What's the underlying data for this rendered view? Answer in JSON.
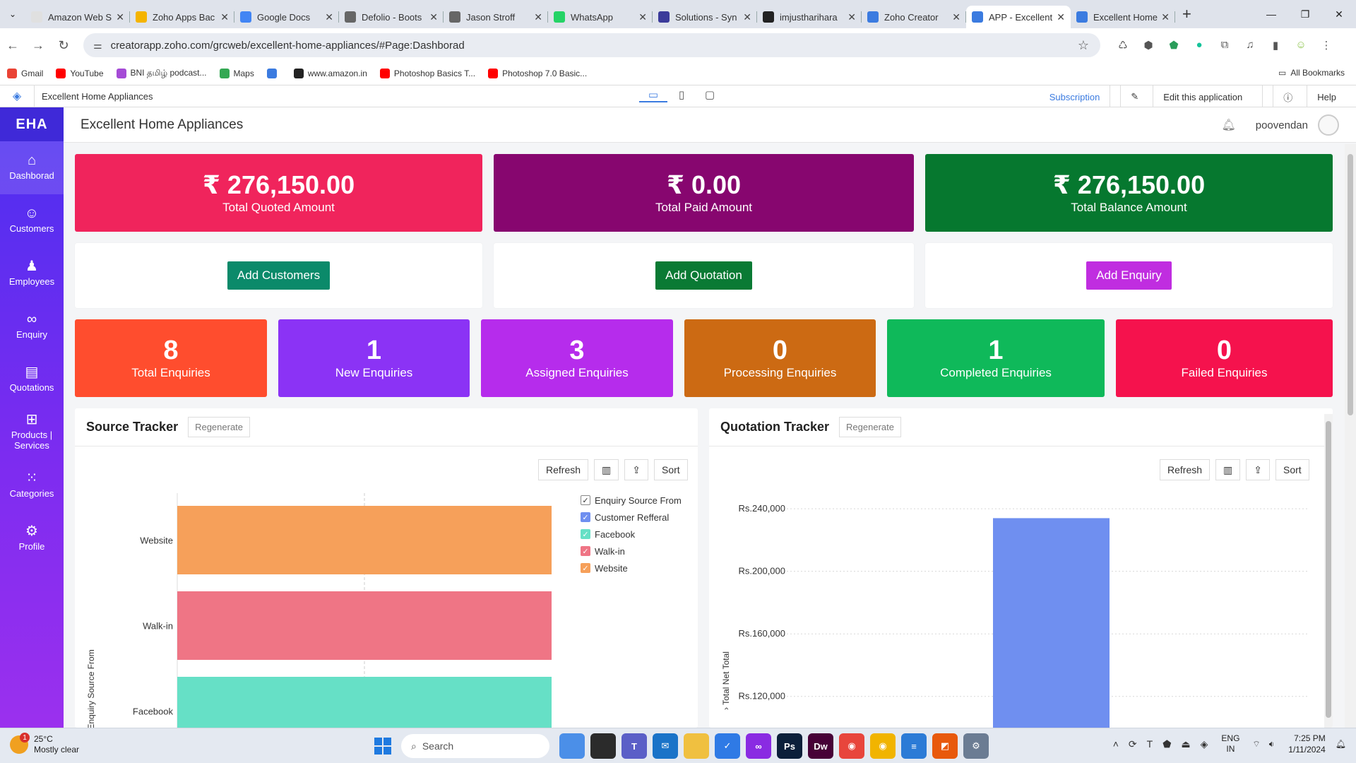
{
  "browser": {
    "tabs": [
      {
        "label": "Amazon Web S",
        "color": "#e0e0e0",
        "icon": "gmail-icon",
        "active": false
      },
      {
        "label": "Zoho Apps Bac",
        "color": "#f4b400",
        "icon": "drive-icon",
        "active": false
      },
      {
        "label": "Google Docs",
        "color": "#4285f4",
        "icon": "docs-icon",
        "active": false
      },
      {
        "label": "Defolio - Boots",
        "color": "#666666",
        "icon": "globe-icon",
        "active": false
      },
      {
        "label": "Jason Stroff",
        "color": "#666666",
        "icon": "globe-icon",
        "active": false
      },
      {
        "label": "WhatsApp",
        "color": "#25d366",
        "icon": "whatsapp-icon",
        "active": false
      },
      {
        "label": "Solutions - Syn",
        "color": "#3b3b9a",
        "icon": "globe-icon",
        "active": false
      },
      {
        "label": "imjustharihara",
        "color": "#222222",
        "icon": "github-icon",
        "active": false
      },
      {
        "label": "Zoho Creator",
        "color": "#3b7be0",
        "icon": "zoho-creator-icon",
        "active": false
      },
      {
        "label": "APP - Excellent",
        "color": "#3b7be0",
        "icon": "zoho-creator-icon",
        "active": true
      },
      {
        "label": "Excellent Home",
        "color": "#3b7be0",
        "icon": "zoho-creator-icon",
        "active": false
      }
    ],
    "url": "creatorapp.zoho.com/grcweb/excellent-home-appliances/#Page:Dashborad",
    "bookmarks": [
      {
        "label": "Gmail",
        "color": "#ea4335"
      },
      {
        "label": "YouTube",
        "color": "#ff0000"
      },
      {
        "label": "BNI தமிழ் podcast...",
        "color": "#a54bd6"
      },
      {
        "label": "Maps",
        "color": "#34a853"
      },
      {
        "label": "",
        "color": "#3b7be0"
      },
      {
        "label": "www.amazon.in",
        "color": "#222222"
      },
      {
        "label": "Photoshop Basics T...",
        "color": "#ff0000"
      },
      {
        "label": "Photoshop 7.0 Basic...",
        "color": "#ff0000"
      }
    ],
    "all_bookmarks": "All Bookmarks"
  },
  "app_topbar": {
    "app_name": "Excellent Home Appliances",
    "subscription": "Subscription",
    "edit": "Edit this application",
    "help": "Help"
  },
  "sidebar": {
    "brand": "EHA",
    "items": [
      {
        "label": "Dashborad",
        "icon": "dashboard-icon",
        "active": true
      },
      {
        "label": "Customers",
        "icon": "user-icon",
        "active": false
      },
      {
        "label": "Employees",
        "icon": "employees-icon",
        "active": false
      },
      {
        "label": "Enquiry",
        "icon": "link-icon",
        "active": false
      },
      {
        "label": "Quotations",
        "icon": "clipboard-icon",
        "active": false
      },
      {
        "label": "Products | Services",
        "icon": "gift-icon",
        "active": false
      },
      {
        "label": "Categories",
        "icon": "grid-icon",
        "active": false
      },
      {
        "label": "Profile",
        "icon": "gear-icon",
        "active": false
      }
    ]
  },
  "header": {
    "title": "Excellent Home Appliances",
    "username": "poovendan"
  },
  "kpis": [
    {
      "amount": "₹ 276,150.00",
      "label": "Total Quoted Amount",
      "color": "#f0245c"
    },
    {
      "amount": "₹ 0.00",
      "label": "Total Paid Amount",
      "color": "#87066f"
    },
    {
      "amount": "₹ 276,150.00",
      "label": "Total Balance Amount",
      "color": "#06782f"
    }
  ],
  "actions": [
    {
      "label": "Add Customers",
      "color": "#0b8a6a"
    },
    {
      "label": "Add Quotation",
      "color": "#0a7a34"
    },
    {
      "label": "Add Enquiry",
      "color": "#c02de0"
    }
  ],
  "counts": [
    {
      "value": "8",
      "label": "Total Enquiries",
      "color": "#ff4d2e"
    },
    {
      "value": "1",
      "label": "New Enquiries",
      "color": "#8b33f5"
    },
    {
      "value": "3",
      "label": "Assigned Enquiries",
      "color": "#b62cec"
    },
    {
      "value": "0",
      "label": "Processing Enquiries",
      "color": "#cc6a13"
    },
    {
      "value": "1",
      "label": "Completed Enquiries",
      "color": "#0fb95a"
    },
    {
      "value": "0",
      "label": "Failed Enquiries",
      "color": "#f5124d"
    }
  ],
  "source_tracker": {
    "title": "Source Tracker",
    "regenerate": "Regenerate",
    "refresh": "Refresh",
    "sort": "Sort",
    "legend_title": "Enquiry Source From",
    "y_axis_label": "Enquiry Source From"
  },
  "quotation_tracker": {
    "title": "Quotation Tracker",
    "regenerate": "Regenerate",
    "refresh": "Refresh",
    "sort": "Sort",
    "y_axis_label": "Total Net Total"
  },
  "chart_data": [
    {
      "type": "bar",
      "orientation": "horizontal",
      "categories": [
        "Website",
        "Walk-in",
        "Facebook"
      ],
      "values": [
        2,
        2,
        2
      ],
      "colors": [
        "#f6a05a",
        "#ef7585",
        "#66e0c6"
      ],
      "legend": [
        {
          "name": "Customer Refferal",
          "color": "#6f8ff0"
        },
        {
          "name": "Facebook",
          "color": "#66e0c6"
        },
        {
          "name": "Walk-in",
          "color": "#ef7585"
        },
        {
          "name": "Website",
          "color": "#f6a05a"
        }
      ],
      "xlim": [
        0,
        2
      ],
      "ylabel": "Enquiry Source From",
      "legend_position": "right",
      "grid": true
    },
    {
      "type": "bar",
      "categories": [
        ""
      ],
      "values": [
        234000
      ],
      "colors": [
        "#6f8ff0"
      ],
      "ylabel": "Total Net Total",
      "yticks": [
        "Rs.120,000",
        "Rs.160,000",
        "Rs.200,000",
        "Rs.240,000"
      ],
      "ylim": [
        100000,
        250000
      ],
      "grid": true
    }
  ],
  "taskbar": {
    "temp": "25°C",
    "weather": "Mostly clear",
    "notif_count": "1",
    "search": "Search",
    "lang_top": "ENG",
    "lang_bottom": "IN",
    "time": "7:25 PM",
    "date": "1/11/2024",
    "apps": [
      {
        "icon": "copilot-icon",
        "color": "#4b8fe8",
        "text": ""
      },
      {
        "icon": "taskview-icon",
        "color": "#2b2b2b",
        "text": ""
      },
      {
        "icon": "teams-icon",
        "color": "#5b5fc7",
        "text": "T"
      },
      {
        "icon": "mail-icon",
        "color": "#1a73c8",
        "text": "✉"
      },
      {
        "icon": "explorer-icon",
        "color": "#f0c040",
        "text": ""
      },
      {
        "icon": "todo-icon",
        "color": "#2f7ae5",
        "text": "✓"
      },
      {
        "icon": "mask-icon",
        "color": "#8a2be2",
        "text": "∞"
      },
      {
        "icon": "photoshop-icon",
        "color": "#0b1f3a",
        "text": "Ps"
      },
      {
        "icon": "dreamweaver-icon",
        "color": "#470137",
        "text": "Dw"
      },
      {
        "icon": "chrome-icon",
        "color": "#e8453c",
        "text": "◉"
      },
      {
        "icon": "chrome-icon",
        "color": "#f1b400",
        "text": "◉"
      },
      {
        "icon": "notepad-icon",
        "color": "#2c7bd6",
        "text": "≡"
      },
      {
        "icon": "office-icon",
        "color": "#e8590c",
        "text": "◩"
      },
      {
        "icon": "settings-icon",
        "color": "#6b7c93",
        "text": "⚙"
      }
    ]
  }
}
